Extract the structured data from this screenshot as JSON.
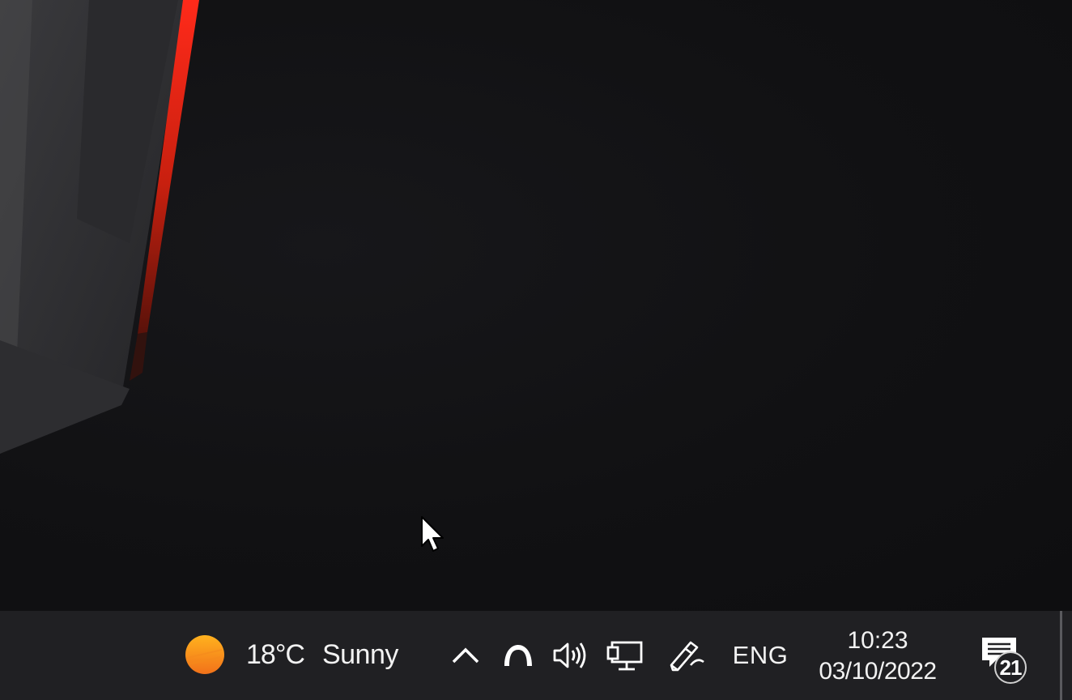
{
  "desktop": {
    "accent_color": "#e8271c"
  },
  "taskbar": {
    "background": "#202023",
    "weather": {
      "icon": "sun-icon",
      "temperature": "18°C",
      "condition": "Sunny"
    },
    "tray": {
      "chevron_icon": "chevron-up-icon",
      "network_icon": "network-icon",
      "volume_icon": "speaker-icon",
      "display_icon": "monitor-icon",
      "pen_icon": "pen-icon",
      "language": "ENG"
    },
    "clock": {
      "time": "10:23",
      "date": "03/10/2022"
    },
    "action_center": {
      "icon": "notification-icon",
      "count": "21"
    }
  }
}
